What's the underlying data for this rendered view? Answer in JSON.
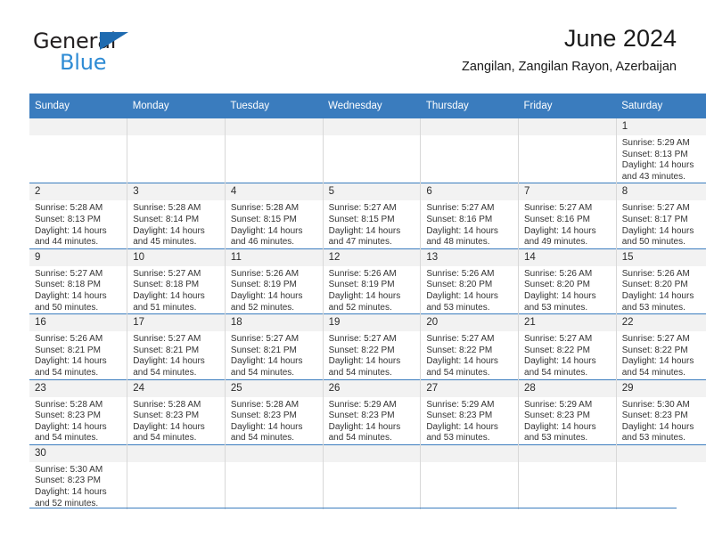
{
  "brand": {
    "name_top": "General",
    "name_bottom": "Blue",
    "accent_color": "#1f6bb0",
    "accent_light": "#2e8bd4",
    "triangle_icon": "triangle-icon"
  },
  "header": {
    "title": "June 2024",
    "subtitle": "Zangilan, Zangilan Rayon, Azerbaijan"
  },
  "calendar": {
    "header_bg": "#3a7cbe",
    "daynum_bg": "#f2f2f2",
    "weekday_headers": [
      "Sunday",
      "Monday",
      "Tuesday",
      "Wednesday",
      "Thursday",
      "Friday",
      "Saturday"
    ],
    "weeks": [
      [
        {
          "day": "",
          "empty": true,
          "sunrise": "",
          "sunset": "",
          "daylight_line1": "",
          "daylight_line2": ""
        },
        {
          "day": "",
          "empty": true,
          "sunrise": "",
          "sunset": "",
          "daylight_line1": "",
          "daylight_line2": ""
        },
        {
          "day": "",
          "empty": true,
          "sunrise": "",
          "sunset": "",
          "daylight_line1": "",
          "daylight_line2": ""
        },
        {
          "day": "",
          "empty": true,
          "sunrise": "",
          "sunset": "",
          "daylight_line1": "",
          "daylight_line2": ""
        },
        {
          "day": "",
          "empty": true,
          "sunrise": "",
          "sunset": "",
          "daylight_line1": "",
          "daylight_line2": ""
        },
        {
          "day": "",
          "empty": true,
          "sunrise": "",
          "sunset": "",
          "daylight_line1": "",
          "daylight_line2": ""
        },
        {
          "day": "1",
          "empty": false,
          "sunrise": "Sunrise: 5:29 AM",
          "sunset": "Sunset: 8:13 PM",
          "daylight_line1": "Daylight: 14 hours",
          "daylight_line2": "and 43 minutes."
        }
      ],
      [
        {
          "day": "2",
          "empty": false,
          "sunrise": "Sunrise: 5:28 AM",
          "sunset": "Sunset: 8:13 PM",
          "daylight_line1": "Daylight: 14 hours",
          "daylight_line2": "and 44 minutes."
        },
        {
          "day": "3",
          "empty": false,
          "sunrise": "Sunrise: 5:28 AM",
          "sunset": "Sunset: 8:14 PM",
          "daylight_line1": "Daylight: 14 hours",
          "daylight_line2": "and 45 minutes."
        },
        {
          "day": "4",
          "empty": false,
          "sunrise": "Sunrise: 5:28 AM",
          "sunset": "Sunset: 8:15 PM",
          "daylight_line1": "Daylight: 14 hours",
          "daylight_line2": "and 46 minutes."
        },
        {
          "day": "5",
          "empty": false,
          "sunrise": "Sunrise: 5:27 AM",
          "sunset": "Sunset: 8:15 PM",
          "daylight_line1": "Daylight: 14 hours",
          "daylight_line2": "and 47 minutes."
        },
        {
          "day": "6",
          "empty": false,
          "sunrise": "Sunrise: 5:27 AM",
          "sunset": "Sunset: 8:16 PM",
          "daylight_line1": "Daylight: 14 hours",
          "daylight_line2": "and 48 minutes."
        },
        {
          "day": "7",
          "empty": false,
          "sunrise": "Sunrise: 5:27 AM",
          "sunset": "Sunset: 8:16 PM",
          "daylight_line1": "Daylight: 14 hours",
          "daylight_line2": "and 49 minutes."
        },
        {
          "day": "8",
          "empty": false,
          "sunrise": "Sunrise: 5:27 AM",
          "sunset": "Sunset: 8:17 PM",
          "daylight_line1": "Daylight: 14 hours",
          "daylight_line2": "and 50 minutes."
        }
      ],
      [
        {
          "day": "9",
          "empty": false,
          "sunrise": "Sunrise: 5:27 AM",
          "sunset": "Sunset: 8:18 PM",
          "daylight_line1": "Daylight: 14 hours",
          "daylight_line2": "and 50 minutes."
        },
        {
          "day": "10",
          "empty": false,
          "sunrise": "Sunrise: 5:27 AM",
          "sunset": "Sunset: 8:18 PM",
          "daylight_line1": "Daylight: 14 hours",
          "daylight_line2": "and 51 minutes."
        },
        {
          "day": "11",
          "empty": false,
          "sunrise": "Sunrise: 5:26 AM",
          "sunset": "Sunset: 8:19 PM",
          "daylight_line1": "Daylight: 14 hours",
          "daylight_line2": "and 52 minutes."
        },
        {
          "day": "12",
          "empty": false,
          "sunrise": "Sunrise: 5:26 AM",
          "sunset": "Sunset: 8:19 PM",
          "daylight_line1": "Daylight: 14 hours",
          "daylight_line2": "and 52 minutes."
        },
        {
          "day": "13",
          "empty": false,
          "sunrise": "Sunrise: 5:26 AM",
          "sunset": "Sunset: 8:20 PM",
          "daylight_line1": "Daylight: 14 hours",
          "daylight_line2": "and 53 minutes."
        },
        {
          "day": "14",
          "empty": false,
          "sunrise": "Sunrise: 5:26 AM",
          "sunset": "Sunset: 8:20 PM",
          "daylight_line1": "Daylight: 14 hours",
          "daylight_line2": "and 53 minutes."
        },
        {
          "day": "15",
          "empty": false,
          "sunrise": "Sunrise: 5:26 AM",
          "sunset": "Sunset: 8:20 PM",
          "daylight_line1": "Daylight: 14 hours",
          "daylight_line2": "and 53 minutes."
        }
      ],
      [
        {
          "day": "16",
          "empty": false,
          "sunrise": "Sunrise: 5:26 AM",
          "sunset": "Sunset: 8:21 PM",
          "daylight_line1": "Daylight: 14 hours",
          "daylight_line2": "and 54 minutes."
        },
        {
          "day": "17",
          "empty": false,
          "sunrise": "Sunrise: 5:27 AM",
          "sunset": "Sunset: 8:21 PM",
          "daylight_line1": "Daylight: 14 hours",
          "daylight_line2": "and 54 minutes."
        },
        {
          "day": "18",
          "empty": false,
          "sunrise": "Sunrise: 5:27 AM",
          "sunset": "Sunset: 8:21 PM",
          "daylight_line1": "Daylight: 14 hours",
          "daylight_line2": "and 54 minutes."
        },
        {
          "day": "19",
          "empty": false,
          "sunrise": "Sunrise: 5:27 AM",
          "sunset": "Sunset: 8:22 PM",
          "daylight_line1": "Daylight: 14 hours",
          "daylight_line2": "and 54 minutes."
        },
        {
          "day": "20",
          "empty": false,
          "sunrise": "Sunrise: 5:27 AM",
          "sunset": "Sunset: 8:22 PM",
          "daylight_line1": "Daylight: 14 hours",
          "daylight_line2": "and 54 minutes."
        },
        {
          "day": "21",
          "empty": false,
          "sunrise": "Sunrise: 5:27 AM",
          "sunset": "Sunset: 8:22 PM",
          "daylight_line1": "Daylight: 14 hours",
          "daylight_line2": "and 54 minutes."
        },
        {
          "day": "22",
          "empty": false,
          "sunrise": "Sunrise: 5:27 AM",
          "sunset": "Sunset: 8:22 PM",
          "daylight_line1": "Daylight: 14 hours",
          "daylight_line2": "and 54 minutes."
        }
      ],
      [
        {
          "day": "23",
          "empty": false,
          "sunrise": "Sunrise: 5:28 AM",
          "sunset": "Sunset: 8:23 PM",
          "daylight_line1": "Daylight: 14 hours",
          "daylight_line2": "and 54 minutes."
        },
        {
          "day": "24",
          "empty": false,
          "sunrise": "Sunrise: 5:28 AM",
          "sunset": "Sunset: 8:23 PM",
          "daylight_line1": "Daylight: 14 hours",
          "daylight_line2": "and 54 minutes."
        },
        {
          "day": "25",
          "empty": false,
          "sunrise": "Sunrise: 5:28 AM",
          "sunset": "Sunset: 8:23 PM",
          "daylight_line1": "Daylight: 14 hours",
          "daylight_line2": "and 54 minutes."
        },
        {
          "day": "26",
          "empty": false,
          "sunrise": "Sunrise: 5:29 AM",
          "sunset": "Sunset: 8:23 PM",
          "daylight_line1": "Daylight: 14 hours",
          "daylight_line2": "and 54 minutes."
        },
        {
          "day": "27",
          "empty": false,
          "sunrise": "Sunrise: 5:29 AM",
          "sunset": "Sunset: 8:23 PM",
          "daylight_line1": "Daylight: 14 hours",
          "daylight_line2": "and 53 minutes."
        },
        {
          "day": "28",
          "empty": false,
          "sunrise": "Sunrise: 5:29 AM",
          "sunset": "Sunset: 8:23 PM",
          "daylight_line1": "Daylight: 14 hours",
          "daylight_line2": "and 53 minutes."
        },
        {
          "day": "29",
          "empty": false,
          "sunrise": "Sunrise: 5:30 AM",
          "sunset": "Sunset: 8:23 PM",
          "daylight_line1": "Daylight: 14 hours",
          "daylight_line2": "and 53 minutes."
        }
      ],
      [
        {
          "day": "30",
          "empty": false,
          "sunrise": "Sunrise: 5:30 AM",
          "sunset": "Sunset: 8:23 PM",
          "daylight_line1": "Daylight: 14 hours",
          "daylight_line2": "and 52 minutes."
        },
        {
          "day": "",
          "empty": true,
          "sunrise": "",
          "sunset": "",
          "daylight_line1": "",
          "daylight_line2": ""
        },
        {
          "day": "",
          "empty": true,
          "sunrise": "",
          "sunset": "",
          "daylight_line1": "",
          "daylight_line2": ""
        },
        {
          "day": "",
          "empty": true,
          "sunrise": "",
          "sunset": "",
          "daylight_line1": "",
          "daylight_line2": ""
        },
        {
          "day": "",
          "empty": true,
          "sunrise": "",
          "sunset": "",
          "daylight_line1": "",
          "daylight_line2": ""
        },
        {
          "day": "",
          "empty": true,
          "sunrise": "",
          "sunset": "",
          "daylight_line1": "",
          "daylight_line2": ""
        },
        {
          "day": "",
          "empty": true,
          "sunrise": "",
          "sunset": "",
          "daylight_line1": "",
          "daylight_line2": ""
        }
      ]
    ]
  }
}
